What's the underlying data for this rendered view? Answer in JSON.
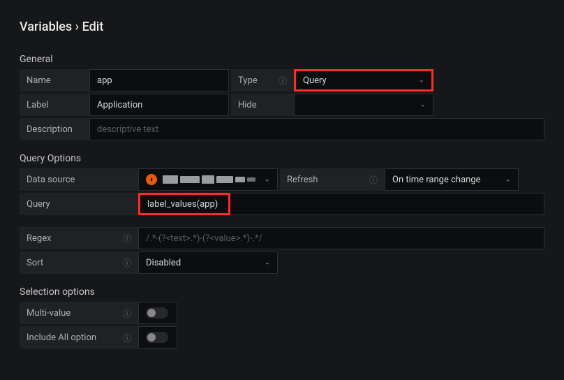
{
  "breadcrumb": {
    "parent": "Variables",
    "separator": "›",
    "current": "Edit"
  },
  "sections": {
    "general": {
      "title": "General"
    },
    "query_options": {
      "title": "Query Options"
    },
    "selection_options": {
      "title": "Selection options"
    }
  },
  "general": {
    "name_label": "Name",
    "name_value": "app",
    "type_label": "Type",
    "type_value": "Query",
    "label_label": "Label",
    "label_value": "Application",
    "hide_label": "Hide",
    "hide_value": "",
    "description_label": "Description",
    "description_placeholder": "descriptive text"
  },
  "query_options": {
    "datasource_label": "Data source",
    "refresh_label": "Refresh",
    "refresh_value": "On time range change",
    "query_label": "Query",
    "query_value": "label_values(app)",
    "regex_label": "Regex",
    "regex_placeholder": "/.*-(?<text>.*)-(?<value>.*)-.*/",
    "sort_label": "Sort",
    "sort_value": "Disabled"
  },
  "selection_options": {
    "multi_value_label": "Multi-value",
    "include_all_label": "Include All option"
  }
}
